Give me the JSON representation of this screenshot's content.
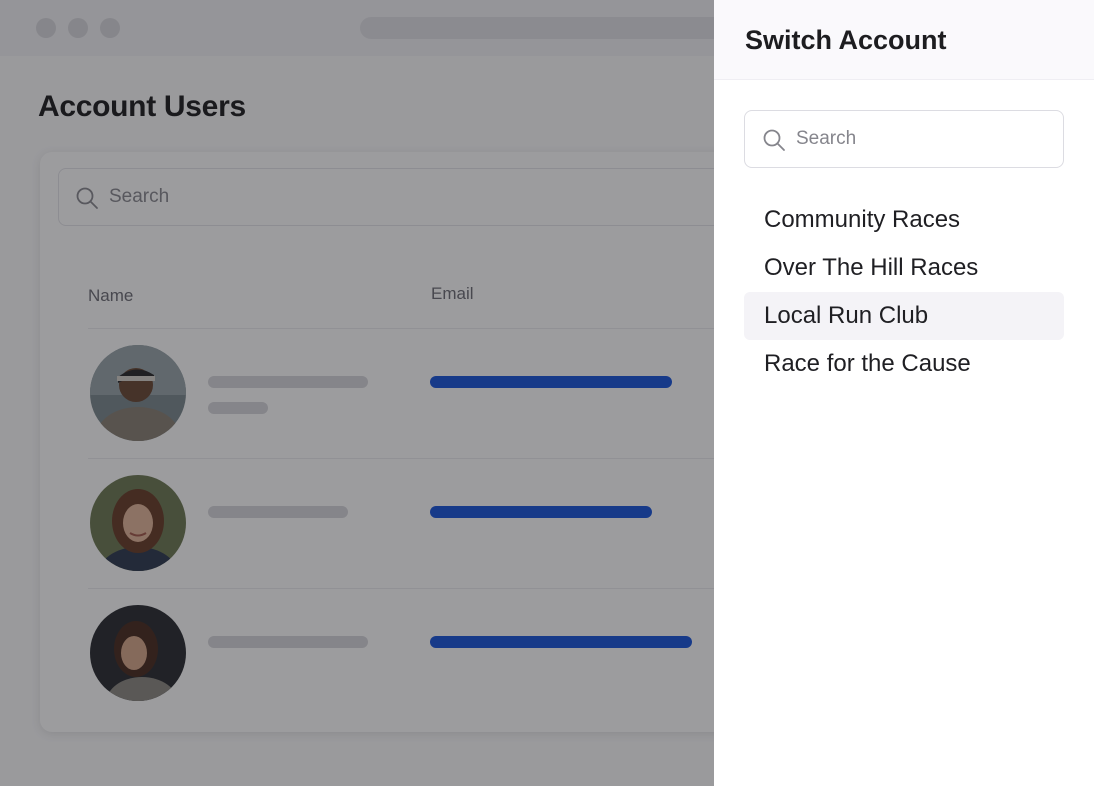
{
  "background": {
    "page_title": "Account Users",
    "search_placeholder": "Search",
    "columns": {
      "name": "Name",
      "email": "Email"
    },
    "users": [
      {
        "avatar": "man-with-headband-avatar"
      },
      {
        "avatar": "woman-smiling-avatar"
      },
      {
        "avatar": "woman-dark-background-avatar"
      }
    ]
  },
  "panel": {
    "title": "Switch Account",
    "search_placeholder": "Search",
    "accounts": [
      {
        "label": "Community Races",
        "selected": false
      },
      {
        "label": "Over The Hill Races",
        "selected": false
      },
      {
        "label": "Local Run Club",
        "selected": true
      },
      {
        "label": "Race for the Cause",
        "selected": false
      }
    ]
  },
  "colors": {
    "accent": "#1a56db",
    "overlay": "#141418",
    "selected_item_bg": "#f4f3f7"
  }
}
